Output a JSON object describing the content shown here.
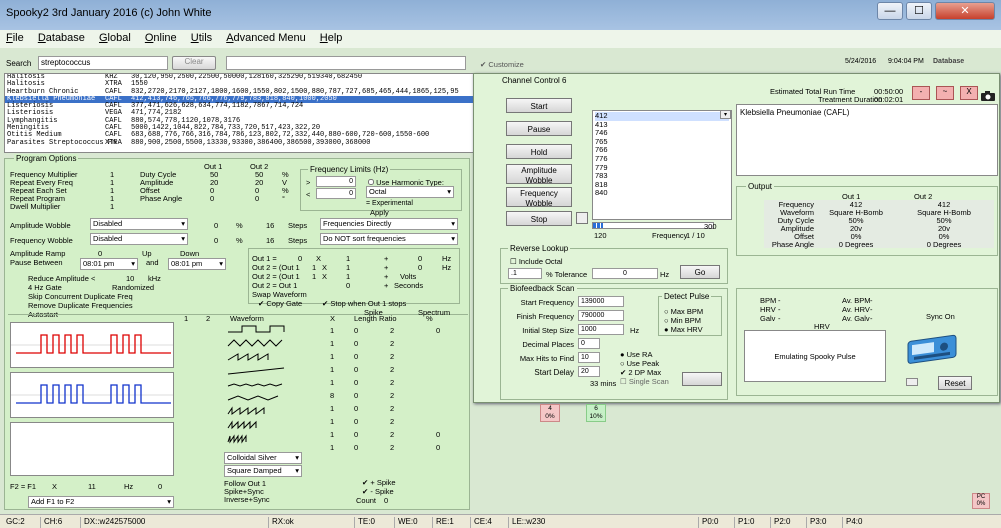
{
  "window": {
    "title": "Spooky2 3rd January 2016 (c) John White",
    "minimize": "—",
    "maximize": "☐",
    "close": "✕"
  },
  "menu": [
    {
      "u": "F",
      "rest": "ile"
    },
    {
      "u": "D",
      "rest": "atabase"
    },
    {
      "u": "G",
      "rest": "lobal"
    },
    {
      "u": "O",
      "rest": "nline"
    },
    {
      "u": "U",
      "rest": "tils"
    },
    {
      "u": "A",
      "rest": "dvanced Menu"
    },
    {
      "u": "H",
      "rest": "elp"
    }
  ],
  "search": {
    "label": "Search",
    "value": "streptococcus",
    "clear": "Clear",
    "customize": "Customize",
    "date": "5/24/2016",
    "time": "9:04:04 PM",
    "database": "Database"
  },
  "programs": [
    {
      "name": "Halitosis",
      "src": "KHZ",
      "freqs": "30,120,950,2500,22500,50000,128160,325290,519340,682450"
    },
    {
      "name": "Halitosis",
      "src": "XTRA",
      "freqs": "1550"
    },
    {
      "name": "Heartburn Chronic",
      "src": "CAFL",
      "freqs": "832,2720,2170,2127,1800,1600,1550,802,1500,880,787,727,685,465,444,1865,125,95"
    },
    {
      "name": "Klebsiella Pneumoniae",
      "src": "CAFL",
      "freqs": "412,413,746,765,766,776,779,783,818,840,1000,2050"
    },
    {
      "name": "Listeriosis",
      "src": "CAFL",
      "freqs": "377,471,626,628,634,774,1182,7867,714,724"
    },
    {
      "name": "Listeriosis",
      "src": "VEGA",
      "freqs": "471,774,2182"
    },
    {
      "name": "Lymphangitis",
      "src": "CAFL",
      "freqs": "880,574,778,1120,1078,3176"
    },
    {
      "name": "Meningitis",
      "src": "CAFL",
      "freqs": "5000,1422,1044,822,784,733,720,517,423,322,20"
    },
    {
      "name": "Otitis Medium",
      "src": "CAFL",
      "freqs": "683,688,776,766,316,784,786,123,802,72,332,440,880-600,720-600,1550-600"
    },
    {
      "name": "Parasites Streptococcus Pn",
      "src": "XTRA",
      "freqs": "880,900,2500,5500,13330,93300,386400,386500,393000,368000"
    }
  ],
  "program_options": {
    "title": "Program Options",
    "out1": "Out 1",
    "out2": "Out 2",
    "left_rows": [
      {
        "label": "Frequency Multiplier",
        "val": "1"
      },
      {
        "label": "Repeat Every Freq",
        "val": "1"
      },
      {
        "label": "Repeat Each Set",
        "val": "1"
      },
      {
        "label": "Repeat Program",
        "val": "1"
      },
      {
        "label": "Dwell Multiplier",
        "val": "1"
      }
    ],
    "mid_rows": [
      {
        "label": "Duty Cycle",
        "o1": "50",
        "o2": "50",
        "u": "%"
      },
      {
        "label": "Amplitude",
        "o1": "20",
        "o2": "20",
        "u": "V"
      },
      {
        "label": "Offset",
        "o1": "0",
        "o2": "0",
        "u": "%"
      },
      {
        "label": "Phase Angle",
        "o1": "0",
        "o2": "0",
        "u": "°"
      }
    ],
    "freq_limits": "Frequency Limits (Hz)",
    "fl_gt": ">",
    "fl_lt": "<",
    "fl_v1": "0",
    "fl_v2": "0",
    "use_harmonic": "Use Harmonic Type:",
    "harmonic": "Octal",
    "experimental": "= Experimental",
    "apply": "Apply",
    "amp_wobble": "Amplitude Wobble",
    "freq_wobble": "Frequency Wobble",
    "disabled": "Disabled",
    "wob_pct": "0",
    "wob_steps": "16",
    "steps": "Steps",
    "pct": "%",
    "freq_sort1": "Frequencies Directly",
    "freq_sort2": "Do NOT sort frequencies",
    "amp_ramp": "Amplitude Ramp",
    "amp_ramp_val": "0",
    "up": "Up",
    "down": "Down",
    "pause_between": "Pause Between",
    "pause1": "08:01 pm",
    "and": "and",
    "pause2": "08:01 pm",
    "reduce_amp": "Reduce Amplitude <",
    "reduce_val": "10",
    "khz": "kHz",
    "gate": "4 Hz Gate",
    "randomized": "Randomized",
    "skip": "Skip Concurrent Duplicate Freq",
    "remove_dup": "Remove Duplicate Frequencies",
    "autostart": "Autostart",
    "out_eq": [
      {
        "l": "Out 1 =",
        "a": "0",
        "b": "1",
        "c": "0",
        "u": "Hz"
      },
      {
        "l": "Out 2 = (Out 1",
        "a": "1",
        "b": "1",
        "c": "0",
        "u": "Hz"
      },
      {
        "l": "Out 2 = (Out 1",
        "a": "1",
        "b": "1",
        "c": "0",
        "u": "Volts"
      },
      {
        "l": "Out 2 = Out 1",
        "a": "",
        "b": "0",
        "c": "",
        "u": "Seconds"
      }
    ],
    "x": "X",
    "plus": "+",
    "swap": "Swap Waveform",
    "copy_gate": "Copy Gate",
    "stop_out1": "Stop when Out 1 stops",
    "col1": "1",
    "col2": "2",
    "waveform": "Waveform",
    "xcol": "X",
    "spike": "Spike",
    "length_ratio": "Length Ratio",
    "spectrum": "Spectrum",
    "spec_pct": "%",
    "spike_rows": [
      [
        "1",
        "0",
        "2",
        "0"
      ],
      [
        "1",
        "0",
        "2",
        "0"
      ],
      [
        "1",
        "0",
        "2",
        "0"
      ],
      [
        "1",
        "0",
        "2",
        "0"
      ],
      [
        "1",
        "0",
        "2",
        "0"
      ],
      [
        "8",
        "0",
        "2",
        "0"
      ],
      [
        "1",
        "0",
        "2",
        "0"
      ],
      [
        "1",
        "0",
        "2",
        "0"
      ],
      [
        "1",
        "0",
        "2",
        "0"
      ],
      [
        "1",
        "0",
        "2",
        "0"
      ]
    ],
    "colloidal": "Colloidal Silver",
    "square_damped": "Square Damped",
    "follow_out1": "Follow Out 1",
    "spike_sync": "Spike+Sync",
    "inverse_sync": "Inverse+Sync",
    "plus_spike": "+ Spike",
    "minus_spike": "- Spike",
    "count": "Count",
    "count_val": "0",
    "f2": "F2 = F1",
    "f2x": "X",
    "f2val": "11",
    "f2hz": "Hz",
    "f2v2": "0",
    "add_f1_f2": "Add F1 to F2"
  },
  "channel": {
    "title": "Channel Control 6",
    "start": "Start",
    "pause": "Pause",
    "hold": "Hold",
    "amp_wobble": "Amplitude Wobble",
    "freq_wobble": "Frequency Wobble",
    "stop": "Stop",
    "freqs": [
      "412",
      "413",
      "746",
      "765",
      "766",
      "776",
      "779",
      "783",
      "818",
      "840"
    ],
    "progress_min": "120",
    "progress_max": "300",
    "progress": 0.08,
    "freq_label": "Frequency",
    "freq_count": "1 / 10",
    "est_total": "Estimated Total Run Time",
    "est_total_val": "00:50:00",
    "treat_dur": "Treatment Duration",
    "treat_dur_val": "00:02:01",
    "program_name": "Klebsiella Pneumoniae (CAFL)",
    "output": {
      "title": "Output",
      "out1": "Out 1",
      "out2": "Out 2",
      "rows": [
        {
          "l": "Frequency",
          "a": "412",
          "b": "412"
        },
        {
          "l": "Waveform",
          "a": "Square H-Bomb",
          "b": "Square H-Bomb"
        },
        {
          "l": "Duty Cycle",
          "a": "50%",
          "b": "50%"
        },
        {
          "l": "Amplitude",
          "a": "20v",
          "b": "20v"
        },
        {
          "l": "Offset",
          "a": "0%",
          "b": "0%"
        },
        {
          "l": "Phase Angle",
          "a": "0 Degrees",
          "b": "0 Degrees"
        }
      ]
    },
    "reverse": {
      "title": "Reverse Lookup",
      "include_octal": "Include Octal",
      "val": ".1",
      "tol": "% Tolerance",
      "hz_val": "0",
      "hz": "Hz",
      "go": "Go"
    },
    "bio": {
      "title": "Biofeedback Scan",
      "rows": [
        {
          "l": "Start Frequency",
          "v": "139000"
        },
        {
          "l": "Finish Frequency",
          "v": "790000"
        },
        {
          "l": "Initial Step Size",
          "v": "1000",
          "u": "Hz"
        },
        {
          "l": "Decimal Places",
          "v": "0"
        },
        {
          "l": "Max Hits to Find",
          "v": "10"
        },
        {
          "l": "Start Delay",
          "v": "20"
        }
      ],
      "mins": "33 mins",
      "detect": "Detect Pulse",
      "max_bpm": "Max BPM",
      "min_bpm": "Min BPM",
      "max_hrv": "Max HRV",
      "use_ra": "Use RA",
      "use_peak": "Use Peak",
      "dp_max": "2 DP Max",
      "single": "Single Scan"
    },
    "bpm": "BPM",
    "avbpm": "Av. BPM",
    "hrv": "HRV",
    "avhrv": "Av. HRV",
    "galv": "Galv",
    "avgalv": "Av. Galv",
    "dash": "-",
    "hrv_lbl": "HRV",
    "emulating": "Emulating Spooky Pulse",
    "sync": "Sync On",
    "reset": "Reset",
    "minbtn": "-",
    "maxbtn": "~",
    "closebtn": "X"
  },
  "badges": [
    {
      "n": "4",
      "p": "0%"
    },
    {
      "n": "6",
      "p": "10%"
    }
  ],
  "pc": {
    "n": "PC",
    "p": "0%"
  },
  "status": [
    "GC:2",
    "CH:6",
    "DX::w242575000",
    "RX:ok",
    "TE:0",
    "WE:0",
    "RE:1",
    "CE:4",
    "LE::w230",
    "P0:0",
    "P1:0",
    "P2:0",
    "P3:0",
    "P4:0"
  ]
}
